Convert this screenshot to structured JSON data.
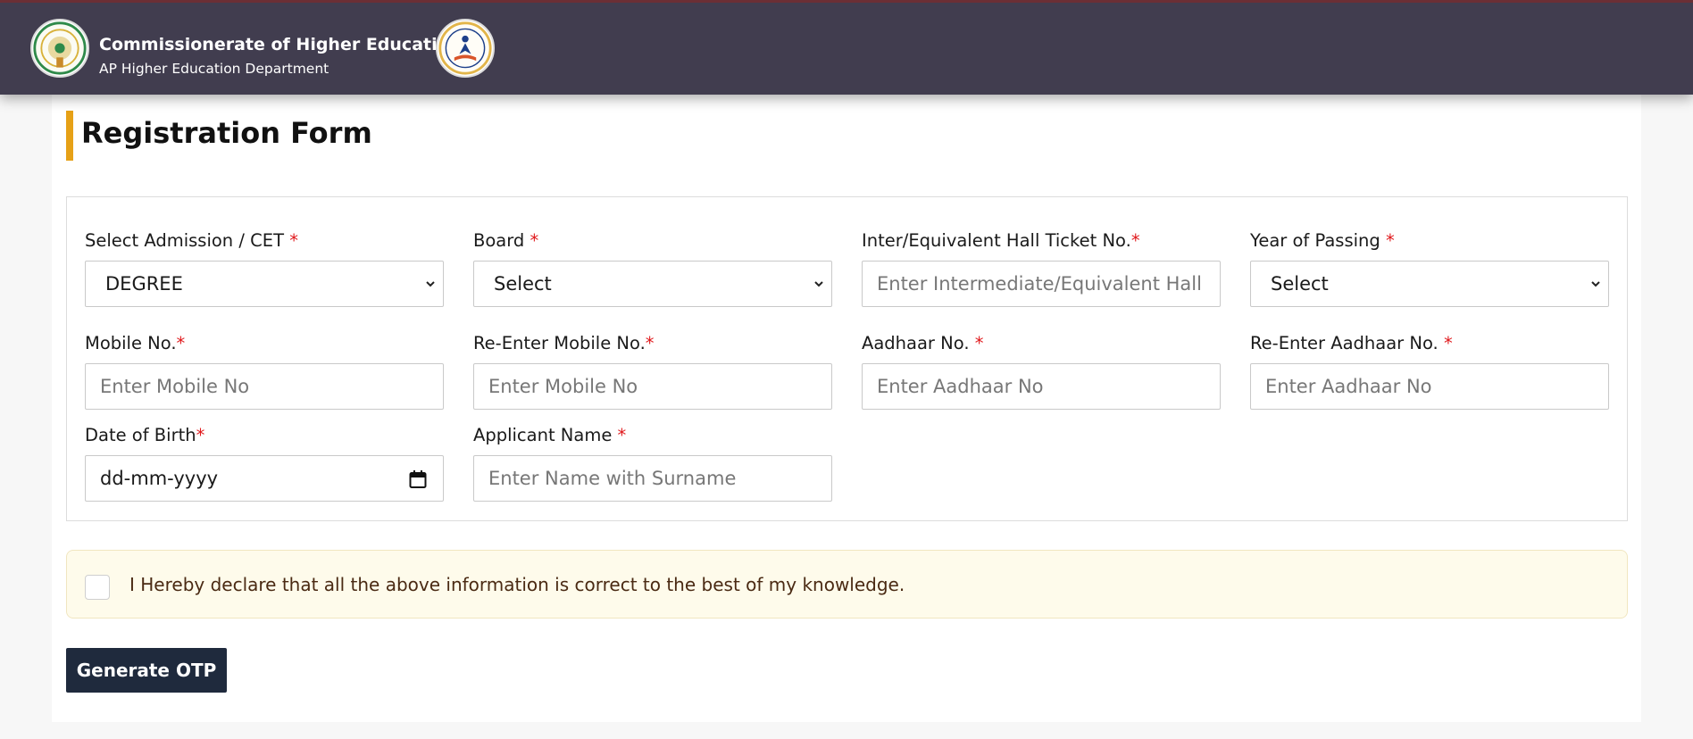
{
  "header": {
    "title": "Commissionerate of Higher Education",
    "subtitle": "AP Higher Education Department"
  },
  "form": {
    "heading": "Registration Form",
    "required_mark": "*",
    "fields": {
      "admission": {
        "label": "Select Admission / CET ",
        "value": "DEGREE"
      },
      "board": {
        "label": "Board ",
        "value": "Select"
      },
      "hall_ticket": {
        "label": "Inter/Equivalent Hall Ticket No.",
        "placeholder": "Enter Intermediate/Equivalent Hall"
      },
      "year_of_passing": {
        "label": "Year of Passing ",
        "value": "Select"
      },
      "mobile": {
        "label": "Mobile No.",
        "placeholder": "Enter Mobile No"
      },
      "re_mobile": {
        "label": "Re-Enter Mobile No.",
        "placeholder": "Enter Mobile No"
      },
      "aadhaar": {
        "label": "Aadhaar No. ",
        "placeholder": "Enter Aadhaar No"
      },
      "re_aadhaar": {
        "label": "Re-Enter Aadhaar No. ",
        "placeholder": "Enter Aadhaar No"
      },
      "dob": {
        "label": "Date of Birth",
        "value": "dd-mm-yyyy"
      },
      "applicant_name": {
        "label": "Applicant Name ",
        "placeholder": "Enter Name with Surname"
      }
    },
    "declaration": "I Hereby declare that all the above information is correct to the best of my knowledge.",
    "declaration_checked": false,
    "submit_label": "Generate OTP"
  },
  "colors": {
    "header_bg": "#413d4f",
    "accent": "#e6a117",
    "required": "#e0191c",
    "button_bg": "#1f2a3d",
    "declaration_bg": "#fefbeb"
  }
}
